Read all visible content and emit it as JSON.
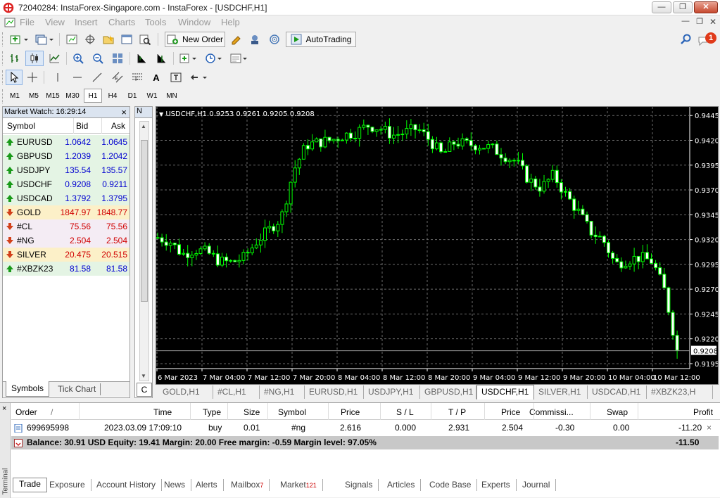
{
  "window": {
    "title": "72040284: InstaForex-Singapore.com - InstaForex - [USDCHF,H1]",
    "minimize": "0",
    "maximize": "1",
    "close": "r"
  },
  "menu": [
    "File",
    "View",
    "Insert",
    "Charts",
    "Tools",
    "Window",
    "Help"
  ],
  "toolbar": {
    "new_order": "New Order",
    "autotrading": "AutoTrading",
    "notification_count": "1"
  },
  "timeframes": [
    "M1",
    "M5",
    "M15",
    "M30",
    "H1",
    "H4",
    "D1",
    "W1",
    "MN"
  ],
  "timeframe_active": "H1",
  "market_watch": {
    "title": "Market Watch: 16:29:14",
    "close": "×",
    "columns": {
      "symbol": "Symbol",
      "bid": "Bid",
      "ask": "Ask"
    },
    "rows": [
      {
        "symbol": "EURUSD",
        "bid": "1.0642",
        "ask": "1.0645",
        "dir": "up",
        "bg": "#e4f4e4",
        "color": "#0000d0"
      },
      {
        "symbol": "GBPUSD",
        "bid": "1.2039",
        "ask": "1.2042",
        "dir": "up",
        "bg": "#e4f4e4",
        "color": "#0000d0"
      },
      {
        "symbol": "USDJPY",
        "bid": "135.54",
        "ask": "135.57",
        "dir": "up",
        "bg": "#e4f4e4",
        "color": "#0000d0"
      },
      {
        "symbol": "USDCHF",
        "bid": "0.9208",
        "ask": "0.9211",
        "dir": "up",
        "bg": "#e4f4e4",
        "color": "#0000d0"
      },
      {
        "symbol": "USDCAD",
        "bid": "1.3792",
        "ask": "1.3795",
        "dir": "up",
        "bg": "#e4f4e4",
        "color": "#0000d0"
      },
      {
        "symbol": "GOLD",
        "bid": "1847.97",
        "ask": "1848.77",
        "dir": "down",
        "bg": "#fcf0c8",
        "color": "#d00000"
      },
      {
        "symbol": "#CL",
        "bid": "75.56",
        "ask": "75.56",
        "dir": "down",
        "bg": "#f4ecf4",
        "color": "#d00000"
      },
      {
        "symbol": "#NG",
        "bid": "2.504",
        "ask": "2.504",
        "dir": "down",
        "bg": "#f4ecf4",
        "color": "#d00000"
      },
      {
        "symbol": "SILVER",
        "bid": "20.475",
        "ask": "20.515",
        "dir": "down",
        "bg": "#fcf0c8",
        "color": "#d00000"
      },
      {
        "symbol": "#XBZK23",
        "bid": "81.58",
        "ask": "81.58",
        "dir": "up",
        "bg": "#e4f4e4",
        "color": "#0000d0"
      }
    ],
    "tabs": [
      "Symbols",
      "Tick Chart"
    ]
  },
  "navigator": {
    "label_top": "N",
    "label_bottom": "C"
  },
  "chart": {
    "header": "USDCHF,H1  0.9253 0.9261 0.9205 0.9208",
    "current_price": "0.9208",
    "up_color": "#00ff00",
    "price_labels": [
      "0.9445",
      "0.9420",
      "0.9395",
      "0.9370",
      "0.9345",
      "0.9320",
      "0.9295",
      "0.9270",
      "0.9245",
      "0.9220",
      "0.9195"
    ],
    "time_labels": [
      "6 Mar 2023",
      "7 Mar 04:00",
      "7 Mar 12:00",
      "7 Mar 20:00",
      "8 Mar 04:00",
      "8 Mar 12:00",
      "8 Mar 20:00",
      "9 Mar 04:00",
      "9 Mar 12:00",
      "9 Mar 20:00",
      "10 Mar 04:00",
      "10 Mar 12:00"
    ],
    "close_path": [
      0.9322,
      0.9318,
      0.9305,
      0.931,
      0.9307,
      0.9298,
      0.9297,
      0.9302,
      0.9318,
      0.933,
      0.9342,
      0.939,
      0.9415,
      0.9418,
      0.942,
      0.9425,
      0.9428,
      0.9435,
      0.9432,
      0.9425,
      0.9428,
      0.9432,
      0.942,
      0.9405,
      0.9418,
      0.9416,
      0.9415,
      0.9412,
      0.9405,
      0.9398,
      0.938,
      0.9372,
      0.9385,
      0.9365,
      0.9348,
      0.9328,
      0.932,
      0.9295,
      0.93,
      0.9302,
      0.9298,
      0.9268,
      0.9208
    ]
  },
  "chart_tabs": [
    "GOLD,H1",
    "#CL,H1",
    "#NG,H1",
    "EURUSD,H1",
    "USDJPY,H1",
    "GBPUSD,H1",
    "USDCHF,H1",
    "SILVER,H1",
    "USDCAD,H1",
    "#XBZK23,H"
  ],
  "chart_tab_active": "USDCHF,H1",
  "terminal": {
    "side_label": "Terminal",
    "columns": [
      "Order",
      "/",
      "Time",
      "Type",
      "Size",
      "Symbol",
      "Price",
      "S / L",
      "T / P",
      "Price",
      "Commissi...",
      "Swap",
      "Profit"
    ],
    "order": {
      "order": "699695998",
      "time": "2023.03.09 17:09:10",
      "type": "buy",
      "size": "0.01",
      "symbol": "#ng",
      "price": "2.616",
      "sl": "0.000",
      "tp": "2.931",
      "price2": "2.504",
      "commission": "-0.30",
      "swap": "0.00",
      "profit": "-11.20",
      "close": "×"
    },
    "balance_line": "Balance: 30.91 USD  Equity: 19.41  Margin: 20.00  Free margin: -0.59  Margin level: 97.05%",
    "balance_profit": "-11.50",
    "tabs": [
      {
        "label": "Trade",
        "count": ""
      },
      {
        "label": "Exposure",
        "count": ""
      },
      {
        "label": "Account History",
        "count": ""
      },
      {
        "label": "News",
        "count": ""
      },
      {
        "label": "Alerts",
        "count": ""
      },
      {
        "label": "Mailbox",
        "count": "7"
      },
      {
        "label": "Market",
        "count": "121"
      },
      {
        "label": "Signals",
        "count": ""
      },
      {
        "label": "Articles",
        "count": ""
      },
      {
        "label": "Code Base",
        "count": ""
      },
      {
        "label": "Experts",
        "count": ""
      },
      {
        "label": "Journal",
        "count": ""
      }
    ]
  }
}
